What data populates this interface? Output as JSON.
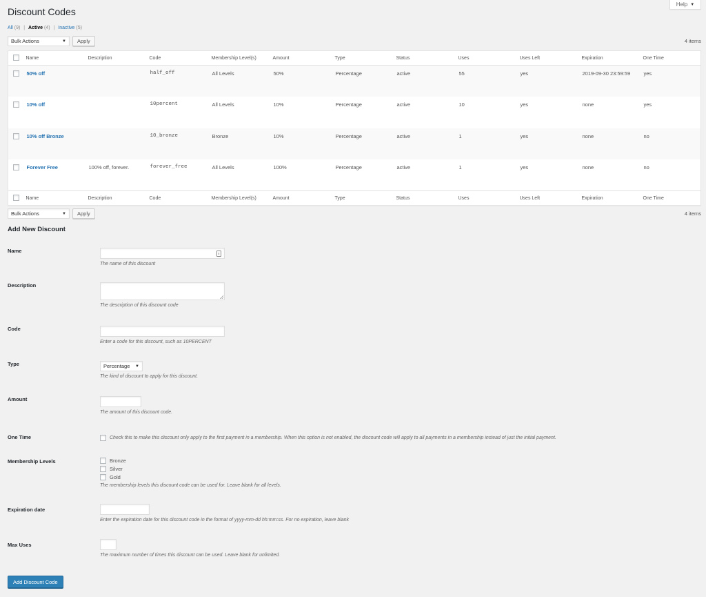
{
  "page": {
    "title": "Discount Codes",
    "help_label": "Help"
  },
  "filters": [
    {
      "label": "All",
      "count": "(9)",
      "current": false
    },
    {
      "label": "Active",
      "count": "(4)",
      "current": true
    },
    {
      "label": "Inactive",
      "count": "(5)",
      "current": false
    }
  ],
  "tablenav": {
    "bulk_actions": "Bulk Actions",
    "apply_label": "Apply",
    "items_count": "4 items"
  },
  "table": {
    "columns": [
      "Name",
      "Description",
      "Code",
      "Membership Level(s)",
      "Amount",
      "Type",
      "Status",
      "Uses",
      "Uses Left",
      "Expiration",
      "One Time"
    ],
    "rows": [
      {
        "name": "50% off",
        "description": "",
        "code": "half_off",
        "levels": "All Levels",
        "amount": "50%",
        "type": "Percentage",
        "status": "active",
        "uses": "55",
        "uses_left": "yes",
        "expiration": "2019-09-30 23:59:59",
        "one_time": "yes"
      },
      {
        "name": "10% off",
        "description": "",
        "code": "10percent",
        "levels": "All Levels",
        "amount": "10%",
        "type": "Percentage",
        "status": "active",
        "uses": "10",
        "uses_left": "yes",
        "expiration": "none",
        "one_time": "yes"
      },
      {
        "name": "10% off Bronze",
        "description": "",
        "code": "10_bronze",
        "levels": "Bronze",
        "amount": "10%",
        "type": "Percentage",
        "status": "active",
        "uses": "1",
        "uses_left": "yes",
        "expiration": "none",
        "one_time": "no"
      },
      {
        "name": "Forever Free",
        "description": "100% off, forever.",
        "code": "forever_free",
        "levels": "All Levels",
        "amount": "100%",
        "type": "Percentage",
        "status": "active",
        "uses": "1",
        "uses_left": "yes",
        "expiration": "none",
        "one_time": "no"
      }
    ]
  },
  "form": {
    "title": "Add New Discount",
    "name": {
      "label": "Name",
      "value": "",
      "help": "The name of this discount"
    },
    "description": {
      "label": "Description",
      "value": "",
      "help": "The description of this discount code"
    },
    "code": {
      "label": "Code",
      "value": "",
      "help": "Enter a code for this discount, such as 10PERCENT"
    },
    "type": {
      "label": "Type",
      "value": "Percentage",
      "help": "The kind of discount to apply for this discount."
    },
    "amount": {
      "label": "Amount",
      "value": "",
      "help": "The amount of this discount code."
    },
    "one_time": {
      "label": "One Time",
      "checked": false,
      "help": "Check this to make this discount only apply to the first payment in a membership. When this option is not enabled, the discount code will apply to all payments in a membership instead of just the initial payment."
    },
    "levels": {
      "label": "Membership Levels",
      "options": [
        {
          "label": "Bronze",
          "checked": false
        },
        {
          "label": "Silver",
          "checked": false
        },
        {
          "label": "Gold",
          "checked": false
        }
      ],
      "help": "The membership levels this discount code can be used for. Leave blank for all levels."
    },
    "expiration": {
      "label": "Expiration date",
      "value": "",
      "help": "Enter the expiration date for this discount code in the format of yyyy-mm-dd hh:mm:ss. For no expiration, leave blank"
    },
    "max_uses": {
      "label": "Max Uses",
      "value": "",
      "help": "The maximum number of times this discount can be used. Leave blank for unlimited."
    },
    "submit_label": "Add Discount Code"
  },
  "colors": {
    "link": "#2271b1",
    "primary_button": "#2e81b6",
    "background": "#f1f1f1"
  }
}
